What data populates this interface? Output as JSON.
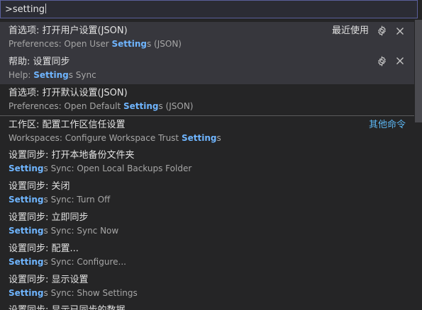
{
  "search": {
    "value": ">setting"
  },
  "items": [
    {
      "title": "首选项: 打开用户设置(JSON)",
      "detail_pre": "Preferences: Open User ",
      "detail_hl": "Setting",
      "detail_post": "s (JSON)",
      "tag": "最近使用"
    },
    {
      "title": "帮助: 设置同步",
      "detail_pre": "Help: ",
      "detail_hl": "Setting",
      "detail_post": "s Sync"
    },
    {
      "title": "首选项: 打开默认设置(JSON)",
      "detail_pre": "Preferences: Open Default ",
      "detail_hl": "Setting",
      "detail_post": "s (JSON)"
    },
    {
      "title": "工作区: 配置工作区信任设置",
      "detail_pre": "Workspaces: Configure Workspace Trust ",
      "detail_hl": "Setting",
      "detail_post": "s",
      "tag": "其他命令"
    },
    {
      "title": "设置同步: 打开本地备份文件夹",
      "detail_pre": "",
      "detail_hl": "Setting",
      "detail_post": "s Sync: Open Local Backups Folder"
    },
    {
      "title": "设置同步: 关闭",
      "detail_pre": "",
      "detail_hl": "Setting",
      "detail_post": "s Sync: Turn Off"
    },
    {
      "title": "设置同步: 立即同步",
      "detail_pre": "",
      "detail_hl": "Setting",
      "detail_post": "s Sync: Sync Now"
    },
    {
      "title": "设置同步: 配置...",
      "detail_pre": "",
      "detail_hl": "Setting",
      "detail_post": "s Sync: Configure..."
    },
    {
      "title": "设置同步: 显示设置",
      "detail_pre": "",
      "detail_hl": "Setting",
      "detail_post": "s Sync: Show Settings"
    }
  ],
  "cut_item": {
    "title": "设置同步: 显示已同步的数据"
  },
  "icons": {
    "gear": "gear-icon",
    "close": "close-icon"
  },
  "colors": {
    "highlight": "#6fb5ff",
    "link": "#5cb6f2",
    "input_border": "#5a5f9a"
  }
}
